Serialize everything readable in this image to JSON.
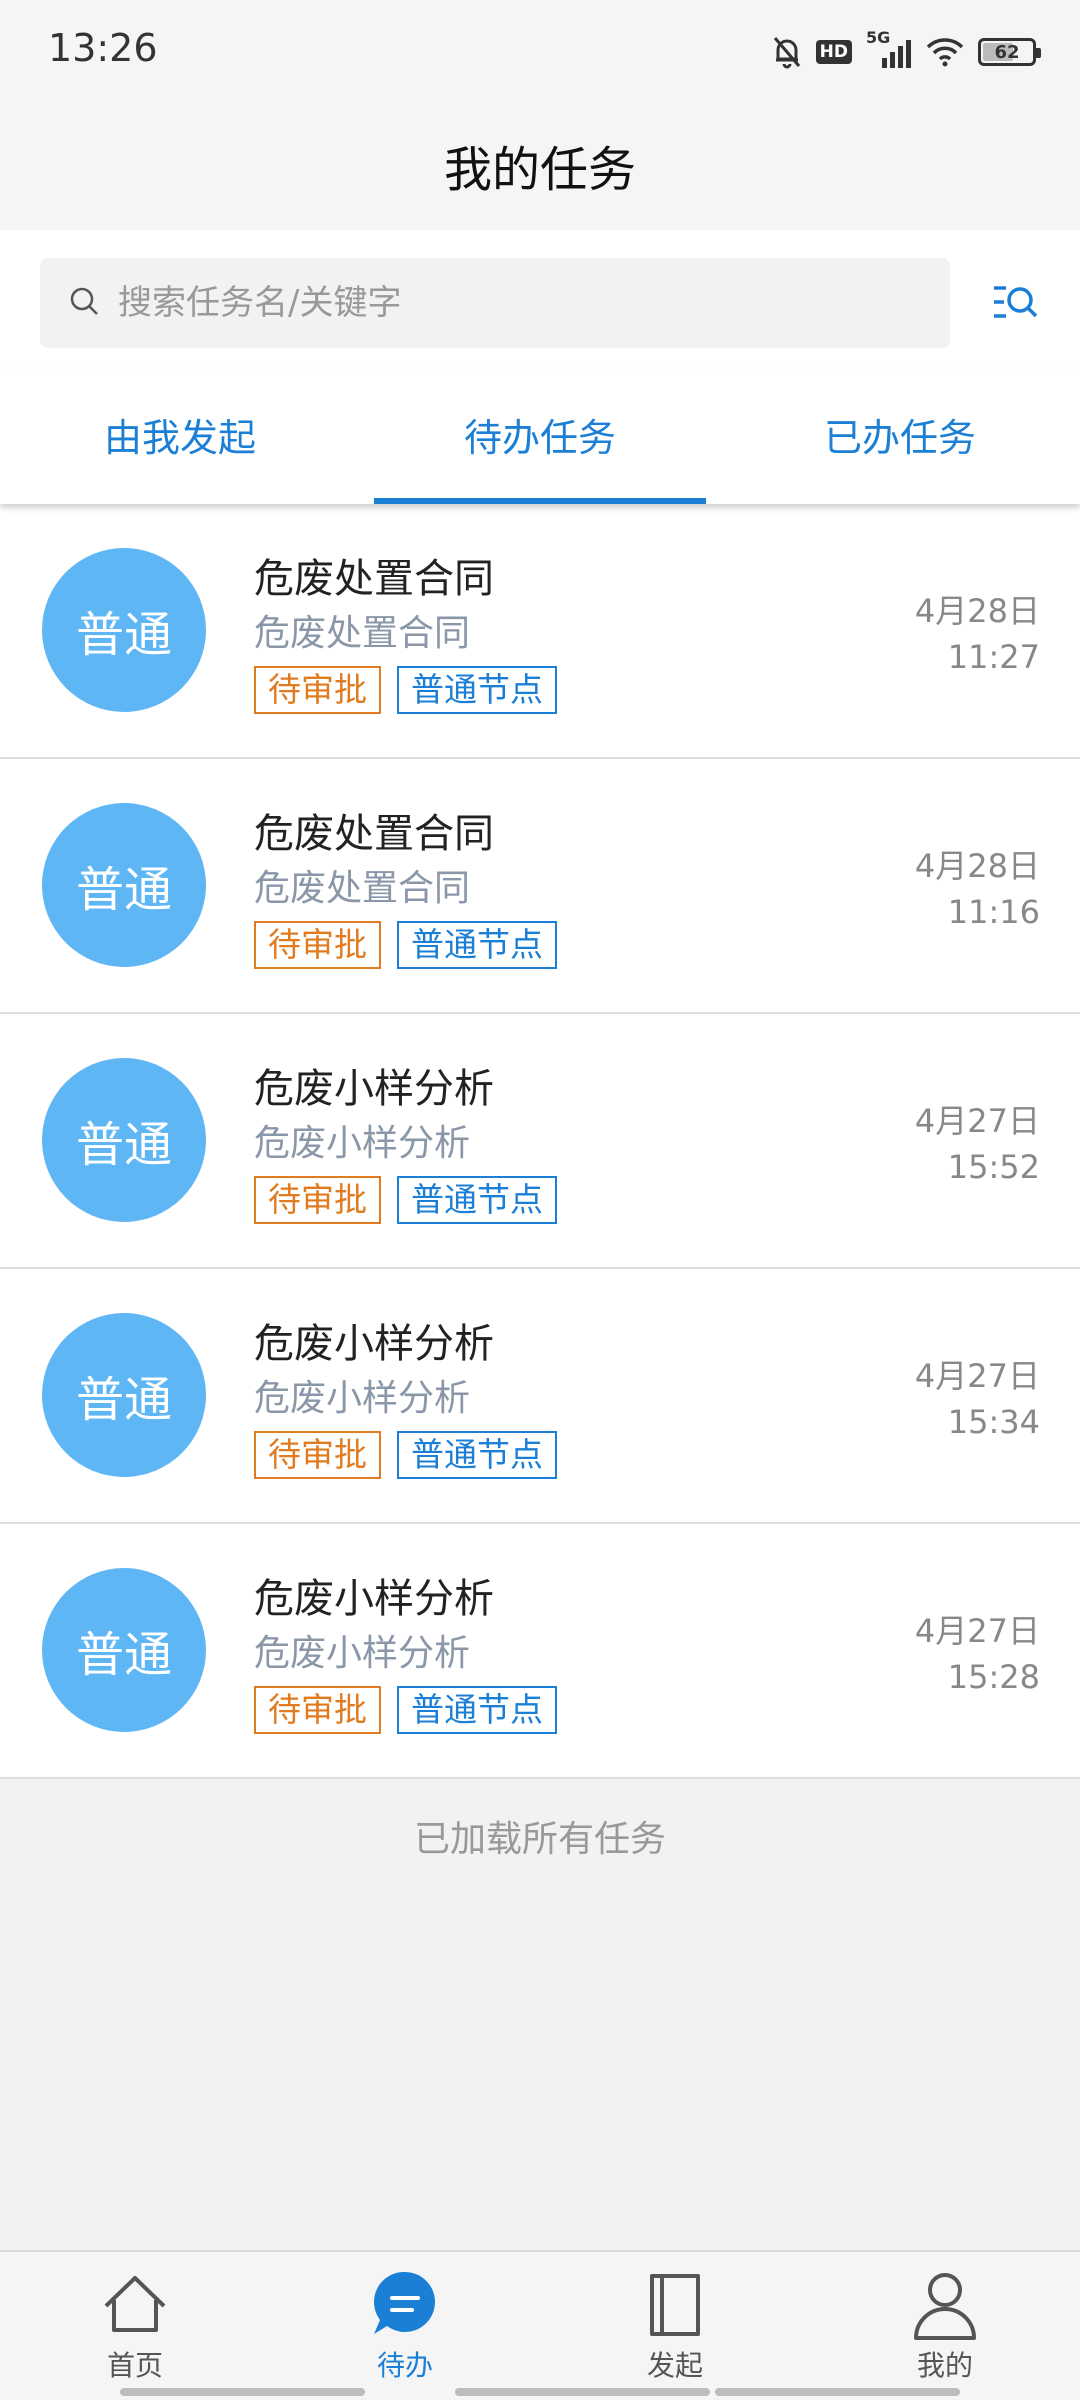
{
  "status_bar": {
    "time": "13:26",
    "network": "5G",
    "hd": "HD",
    "battery": "62",
    "battery_level": 0.62
  },
  "header": {
    "title": "我的任务"
  },
  "search": {
    "placeholder": "搜索任务名/关键字"
  },
  "tabs": [
    {
      "label": "由我发起",
      "active": false
    },
    {
      "label": "待办任务",
      "active": true
    },
    {
      "label": "已办任务",
      "active": false
    }
  ],
  "tasks": [
    {
      "avatar": "普通",
      "title": "危废处置合同",
      "subtitle": "危废处置合同",
      "tags": [
        "待审批",
        "普通节点"
      ],
      "date": "4月28日",
      "time": "11:27"
    },
    {
      "avatar": "普通",
      "title": "危废处置合同",
      "subtitle": "危废处置合同",
      "tags": [
        "待审批",
        "普通节点"
      ],
      "date": "4月28日",
      "time": "11:16"
    },
    {
      "avatar": "普通",
      "title": "危废小样分析",
      "subtitle": "危废小样分析",
      "tags": [
        "待审批",
        "普通节点"
      ],
      "date": "4月27日",
      "time": "15:52"
    },
    {
      "avatar": "普通",
      "title": "危废小样分析",
      "subtitle": "危废小样分析",
      "tags": [
        "待审批",
        "普通节点"
      ],
      "date": "4月27日",
      "time": "15:34"
    },
    {
      "avatar": "普通",
      "title": "危废小样分析",
      "subtitle": "危废小样分析",
      "tags": [
        "待审批",
        "普通节点"
      ],
      "date": "4月27日",
      "time": "15:28"
    }
  ],
  "footer_message": "已加载所有任务",
  "bottom_nav": [
    {
      "label": "首页",
      "icon": "home-icon",
      "active": false
    },
    {
      "label": "待办",
      "icon": "todo-chat-icon",
      "active": true
    },
    {
      "label": "发起",
      "icon": "document-icon",
      "active": false
    },
    {
      "label": "我的",
      "icon": "user-icon",
      "active": false
    }
  ],
  "colors": {
    "accent": "#1c7fd6",
    "avatar": "#5fb6f5",
    "tag_pending": "#e17b1f"
  }
}
